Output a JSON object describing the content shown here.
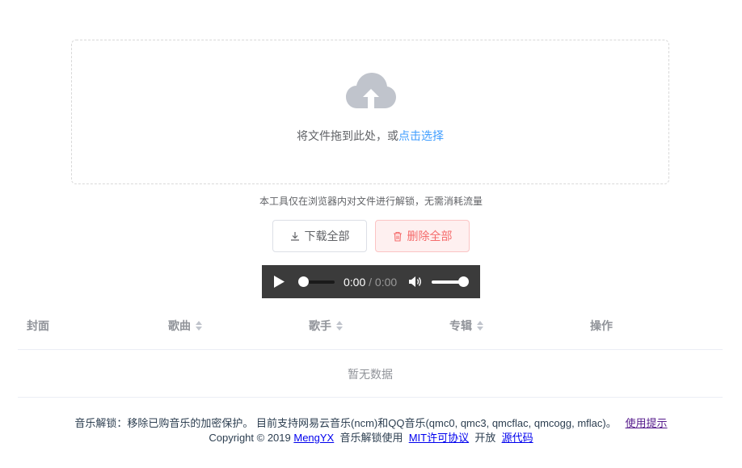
{
  "upload": {
    "icon": "cloud-upload-icon",
    "text": "将文件拖到此处，或",
    "link": "点击选择"
  },
  "tip": "本工具仅在浏览器内对文件进行解锁，无需消耗流量",
  "actions": {
    "download_label": "下载全部",
    "download_icon": "download-icon",
    "delete_label": "删除全部",
    "delete_icon": "trash-icon"
  },
  "player": {
    "current_time": "0:00",
    "separator": " / ",
    "duration": "0:00",
    "play_icon": "play-icon",
    "volume_icon": "volume-icon"
  },
  "table": {
    "columns": [
      "封面",
      "歌曲",
      "歌手",
      "专辑",
      "操作"
    ],
    "empty_text": "暂无数据"
  },
  "footer": {
    "description": "音乐解锁：移除已购音乐的加密保护。 目前支持网易云音乐(ncm)和QQ音乐(qmc0, qmc3, qmcflac, qmcogg, mflac)。",
    "help_link": "使用提示",
    "copyright": "Copyright © 2019",
    "author_link": "MengYX",
    "usage_text": "音乐解锁使用",
    "license_link": "MIT许可协议",
    "open_text": "开放",
    "source_link": "源代码"
  },
  "colors": {
    "accent": "#409eff",
    "danger": "#f56c6c",
    "player_bg": "#3b3b3b"
  }
}
